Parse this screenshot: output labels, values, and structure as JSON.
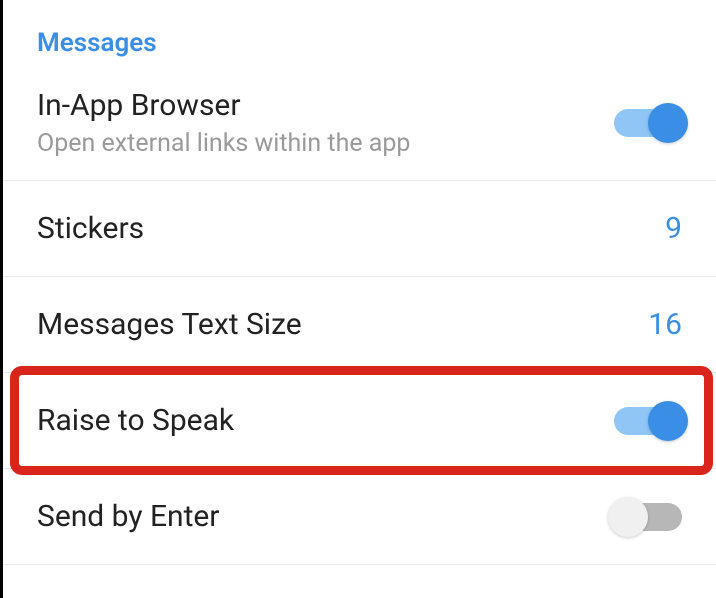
{
  "section": {
    "header": "Messages"
  },
  "settings": {
    "inAppBrowser": {
      "title": "In-App Browser",
      "subtitle": "Open external links within the app",
      "enabled": true
    },
    "stickers": {
      "title": "Stickers",
      "value": "9"
    },
    "textSize": {
      "title": "Messages Text Size",
      "value": "16"
    },
    "raiseToSpeak": {
      "title": "Raise to Speak",
      "enabled": true,
      "highlighted": true
    },
    "sendByEnter": {
      "title": "Send by Enter",
      "enabled": false
    }
  }
}
